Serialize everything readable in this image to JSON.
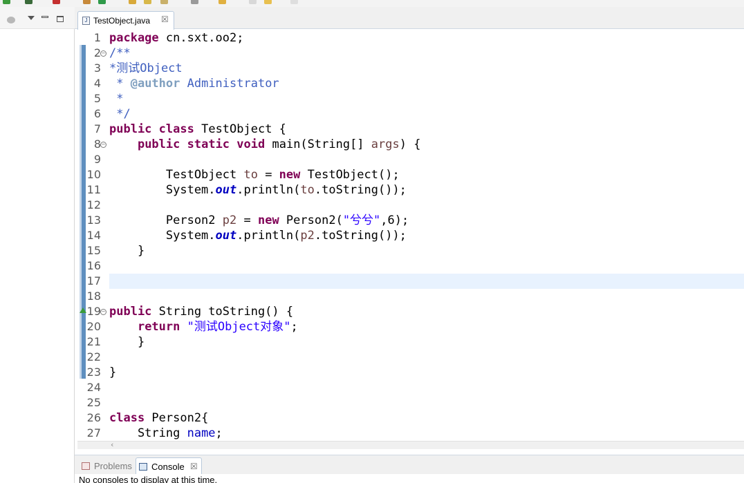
{
  "editor": {
    "tab_label": "TestObject.java",
    "tab_icon": "J",
    "current_line": 17
  },
  "colors": {
    "keyword": "#7f0055",
    "comment": "#3f5fbf",
    "javadoc_tag": "#7f9fbf",
    "string": "#2a00ff",
    "static_field": "#0000c0",
    "local_var": "#6a3e3e",
    "current_line_bg": "#e8f2fe"
  },
  "code": [
    {
      "n": "1",
      "fold": false,
      "tokens": [
        [
          "kw",
          "package"
        ],
        [
          "t",
          " cn.sxt.oo2;"
        ]
      ]
    },
    {
      "n": "2",
      "fold": true,
      "tokens": [
        [
          "cm",
          "/**"
        ]
      ]
    },
    {
      "n": "3",
      "fold": false,
      "tokens": [
        [
          "cm",
          "*测试Object"
        ]
      ]
    },
    {
      "n": "4",
      "fold": false,
      "tokens": [
        [
          "cm",
          " * "
        ],
        [
          "tag",
          "@author"
        ],
        [
          "cm",
          " Administrator"
        ]
      ]
    },
    {
      "n": "5",
      "fold": false,
      "tokens": [
        [
          "cm",
          " *"
        ]
      ]
    },
    {
      "n": "6",
      "fold": false,
      "tokens": [
        [
          "cm",
          " */"
        ]
      ]
    },
    {
      "n": "7",
      "fold": false,
      "tokens": [
        [
          "kw",
          "public"
        ],
        [
          "t",
          " "
        ],
        [
          "kw",
          "class"
        ],
        [
          "t",
          " TestObject {"
        ]
      ]
    },
    {
      "n": "8",
      "fold": true,
      "tokens": [
        [
          "t",
          "    "
        ],
        [
          "kw",
          "public"
        ],
        [
          "t",
          " "
        ],
        [
          "kw",
          "static"
        ],
        [
          "t",
          " "
        ],
        [
          "kw",
          "void"
        ],
        [
          "t",
          " main(String[] "
        ],
        [
          "var",
          "args"
        ],
        [
          "t",
          ") {"
        ]
      ]
    },
    {
      "n": "9",
      "fold": false,
      "tokens": []
    },
    {
      "n": "10",
      "fold": false,
      "tokens": [
        [
          "t",
          "        TestObject "
        ],
        [
          "var",
          "to"
        ],
        [
          "t",
          " = "
        ],
        [
          "kw",
          "new"
        ],
        [
          "t",
          " TestObject();"
        ]
      ]
    },
    {
      "n": "11",
      "fold": false,
      "tokens": [
        [
          "t",
          "        System."
        ],
        [
          "fld",
          "out"
        ],
        [
          "t",
          ".println("
        ],
        [
          "var",
          "to"
        ],
        [
          "t",
          ".toString());"
        ]
      ]
    },
    {
      "n": "12",
      "fold": false,
      "tokens": []
    },
    {
      "n": "13",
      "fold": false,
      "tokens": [
        [
          "t",
          "        Person2 "
        ],
        [
          "var",
          "p2"
        ],
        [
          "t",
          " = "
        ],
        [
          "kw",
          "new"
        ],
        [
          "t",
          " Person2("
        ],
        [
          "str",
          "\"兮兮\""
        ],
        [
          "t",
          ",6);"
        ]
      ]
    },
    {
      "n": "14",
      "fold": false,
      "tokens": [
        [
          "t",
          "        System."
        ],
        [
          "fld",
          "out"
        ],
        [
          "t",
          ".println("
        ],
        [
          "var",
          "p2"
        ],
        [
          "t",
          ".toString());"
        ]
      ]
    },
    {
      "n": "15",
      "fold": false,
      "tokens": [
        [
          "t",
          "    }"
        ]
      ]
    },
    {
      "n": "16",
      "fold": false,
      "tokens": []
    },
    {
      "n": "17",
      "fold": false,
      "tokens": []
    },
    {
      "n": "18",
      "fold": false,
      "tokens": []
    },
    {
      "n": "19",
      "fold": true,
      "override": true,
      "tokens": [
        [
          "kw",
          "public"
        ],
        [
          "t",
          " String toString() {"
        ]
      ]
    },
    {
      "n": "20",
      "fold": false,
      "tokens": [
        [
          "t",
          "    "
        ],
        [
          "kw",
          "return"
        ],
        [
          "t",
          " "
        ],
        [
          "str",
          "\"测试Object对象\""
        ],
        [
          "t",
          ";"
        ]
      ]
    },
    {
      "n": "21",
      "fold": false,
      "tokens": [
        [
          "t",
          "    }"
        ]
      ]
    },
    {
      "n": "22",
      "fold": false,
      "tokens": []
    },
    {
      "n": "23",
      "fold": false,
      "tokens": [
        [
          "t",
          "}"
        ]
      ]
    },
    {
      "n": "24",
      "fold": false,
      "tokens": []
    },
    {
      "n": "25",
      "fold": false,
      "tokens": []
    },
    {
      "n": "26",
      "fold": false,
      "tokens": [
        [
          "kw",
          "class"
        ],
        [
          "t",
          " Person2{"
        ]
      ]
    },
    {
      "n": "27",
      "fold": false,
      "tokens": [
        [
          "t",
          "    String "
        ],
        [
          "fieldname",
          "name"
        ],
        [
          "t",
          ";"
        ]
      ]
    }
  ],
  "bottom": {
    "problems_label": "Problems",
    "console_label": "Console",
    "console_message": "No consoles to display at this time."
  }
}
